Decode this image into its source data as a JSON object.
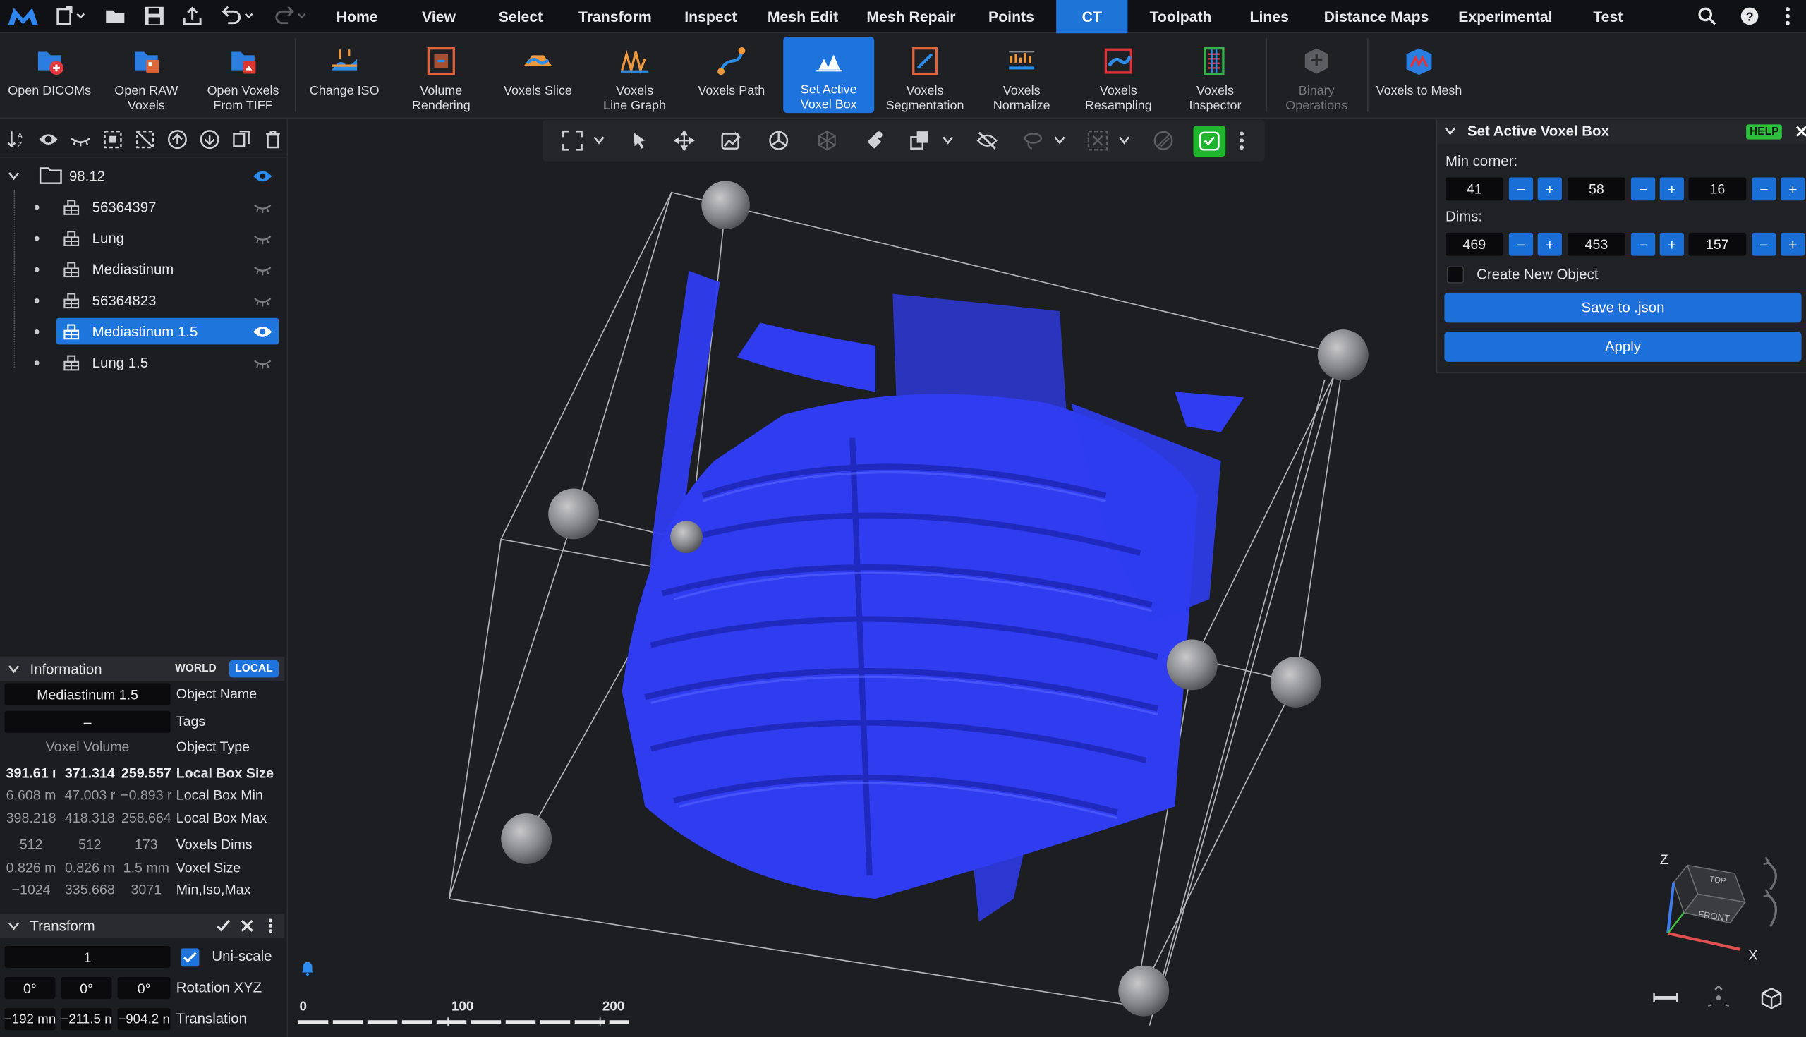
{
  "menubar": {
    "tabs": [
      "Home",
      "View",
      "Select",
      "Transform",
      "Inspect",
      "Mesh Edit",
      "Mesh Repair",
      "Points",
      "CT",
      "Toolpath",
      "Lines",
      "Distance Maps",
      "Experimental",
      "Test"
    ],
    "active_tab": "CT"
  },
  "ribbon": {
    "buttons": [
      {
        "label": "Open DICOMs",
        "icon": "open-dicoms-icon"
      },
      {
        "label": "Open RAW\nVoxels",
        "icon": "open-raw-voxels-icon"
      },
      {
        "label": "Open Voxels\nFrom TIFF",
        "icon": "open-tiff-icon"
      },
      {
        "label": "Change ISO",
        "icon": "change-iso-icon"
      },
      {
        "label": "Volume\nRendering",
        "icon": "volume-rendering-icon"
      },
      {
        "label": "Voxels Slice",
        "icon": "voxels-slice-icon"
      },
      {
        "label": "Voxels\nLine Graph",
        "icon": "line-graph-icon"
      },
      {
        "label": "Voxels Path",
        "icon": "voxels-path-icon"
      },
      {
        "label": "Set Active\nVoxel Box",
        "icon": "voxel-box-icon"
      },
      {
        "label": "Voxels\nSegmentation",
        "icon": "segmentation-icon"
      },
      {
        "label": "Voxels\nNormalize",
        "icon": "normalize-icon"
      },
      {
        "label": "Voxels\nResampling",
        "icon": "resampling-icon"
      },
      {
        "label": "Voxels\nInspector",
        "icon": "inspector-icon"
      },
      {
        "label": "Binary\nOperations",
        "icon": "binary-operations-icon"
      },
      {
        "label": "Voxels to Mesh",
        "icon": "voxels-to-mesh-icon"
      }
    ]
  },
  "scene_tree": {
    "root": "98.12",
    "items": [
      {
        "label": "56364397",
        "visible": false
      },
      {
        "label": "Lung",
        "visible": false
      },
      {
        "label": "Mediastinum",
        "visible": false
      },
      {
        "label": "56364823",
        "visible": false
      },
      {
        "label": "Mediastinum 1.5",
        "visible": true,
        "selected": true
      },
      {
        "label": "Lung 1.5",
        "visible": false
      }
    ]
  },
  "information": {
    "title": "Information",
    "world_label": "WORLD",
    "local_label": "LOCAL",
    "object_name_value": "Mediastinum 1.5",
    "object_name_label": "Object Name",
    "tags_value": "–",
    "tags_label": "Tags",
    "object_type_value": "Voxel Volume",
    "object_type_label": "Object Type",
    "rows": [
      {
        "v": [
          "391.61 ı",
          "371.314",
          "259.557"
        ],
        "label": "Local Box Size",
        "bold": true
      },
      {
        "v": [
          "6.608 m",
          "47.003 r",
          "−0.893 r"
        ],
        "label": "Local Box Min"
      },
      {
        "v": [
          "398.218",
          "418.318",
          "258.664"
        ],
        "label": "Local Box Max"
      },
      {
        "v": [
          "512",
          "512",
          "173"
        ],
        "label": "Voxels Dims"
      },
      {
        "v": [
          "0.826 m",
          "0.826 m",
          "1.5 mm"
        ],
        "label": "Voxel Size"
      },
      {
        "v": [
          "−1024",
          "335.668",
          "3071"
        ],
        "label": "Min,Iso,Max"
      }
    ]
  },
  "transform": {
    "title": "Transform",
    "scale_value": "1",
    "uniscale_label": "Uni-scale",
    "rotation": [
      "0°",
      "0°",
      "0°"
    ],
    "rotation_label": "Rotation XYZ",
    "translation": [
      "−192 mn",
      "−211.5 n",
      "−904.2 n"
    ],
    "translation_label": "Translation"
  },
  "voxel_box_panel": {
    "title": "Set Active Voxel Box",
    "help_label": "HELP",
    "min_corner_label": "Min corner:",
    "min_corner": [
      "41",
      "58",
      "16"
    ],
    "dims_label": "Dims:",
    "dims": [
      "469",
      "453",
      "157"
    ],
    "create_new_label": "Create New Object",
    "create_new_checked": false,
    "save_label": "Save to .json",
    "apply_label": "Apply"
  },
  "scale_bar": {
    "ticks": [
      "0",
      "100",
      "200"
    ]
  },
  "view_cube": {
    "top": "TOP",
    "front": "FRONT",
    "axis_x": "X",
    "axis_z": "Z"
  },
  "colors": {
    "accent": "#1e74dc",
    "volume": "#2f3cf0",
    "bg": "#1d1e22",
    "help": "#2fbf3f"
  }
}
